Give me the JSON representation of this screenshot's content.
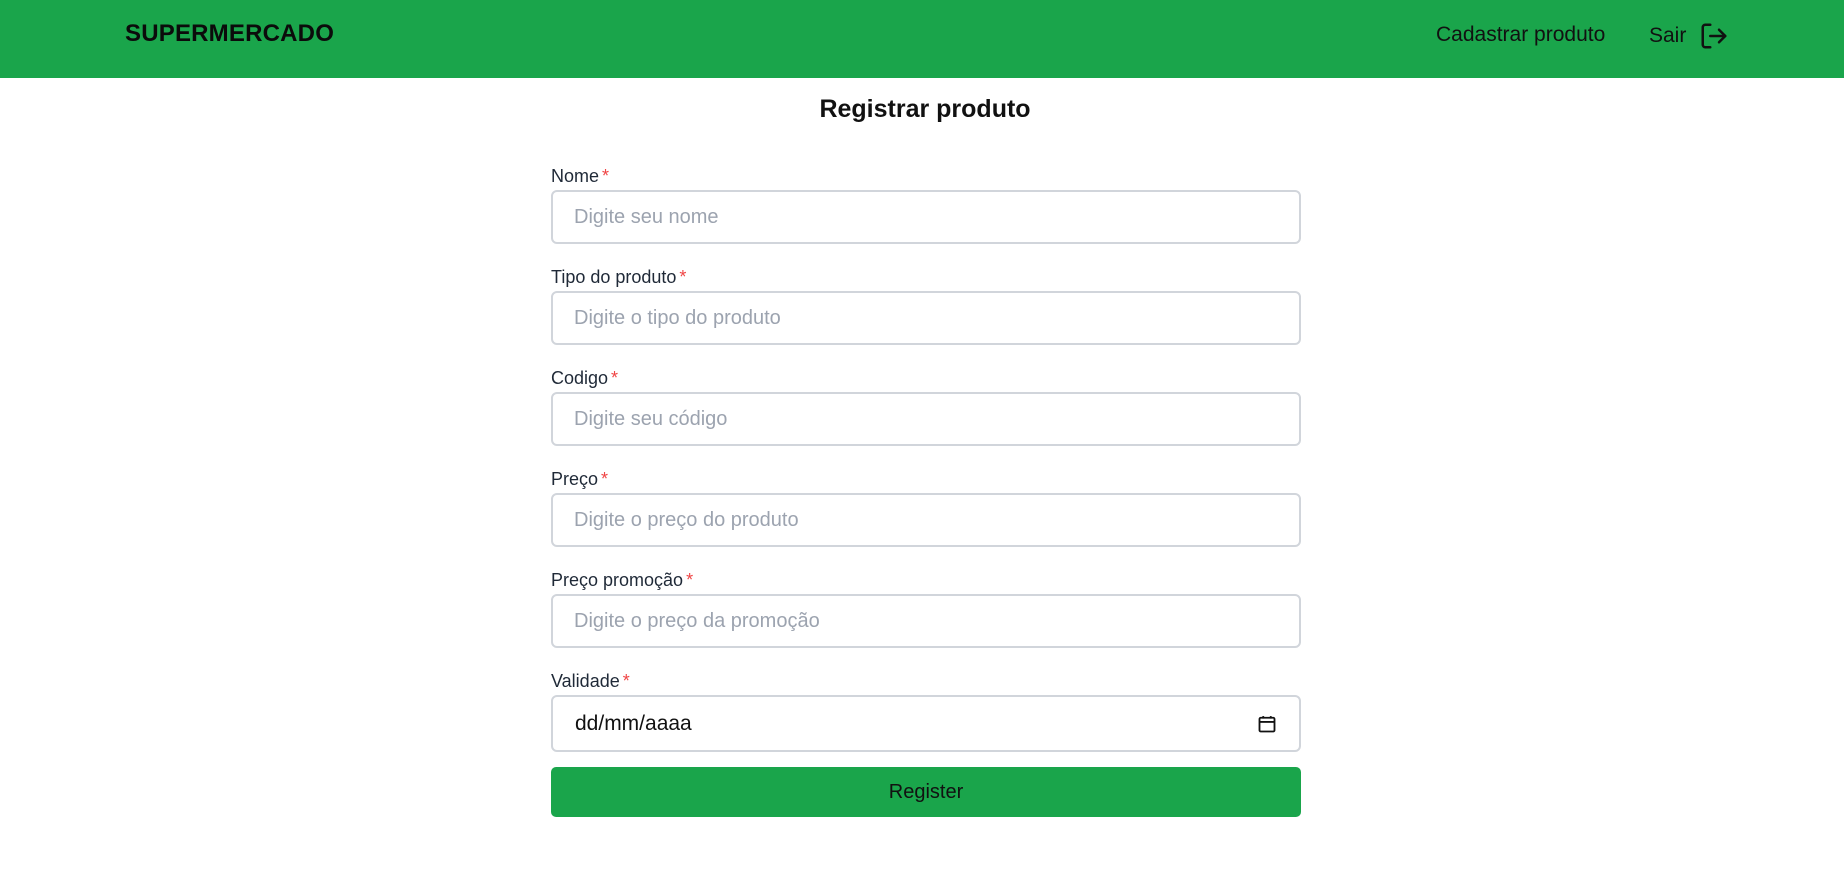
{
  "navbar": {
    "brand": "SUPERMERCADO",
    "links": {
      "cadastrar": "Cadastrar produto",
      "sair": "Sair"
    },
    "background_color": "#1aa54b",
    "logout_icon": "logout-icon"
  },
  "page": {
    "title": "Registrar produto"
  },
  "form": {
    "required_mark": "*",
    "required_color": "#ef4444",
    "fields": [
      {
        "label": "Nome",
        "placeholder": "Digite seu nome",
        "value": ""
      },
      {
        "label": "Tipo do produto",
        "placeholder": "Digite o tipo do produto",
        "value": ""
      },
      {
        "label": "Codigo",
        "placeholder": "Digite seu código",
        "value": ""
      },
      {
        "label": "Preço",
        "placeholder": "Digite o preço do produto",
        "value": ""
      },
      {
        "label": "Preço promoção",
        "placeholder": "Digite o preço da promoção",
        "value": ""
      }
    ],
    "date_field": {
      "label": "Validade",
      "value": "dd/mm/aaaa",
      "icon": "calendar-icon"
    },
    "submit_label": "Register",
    "submit_color": "#1aa54b"
  }
}
